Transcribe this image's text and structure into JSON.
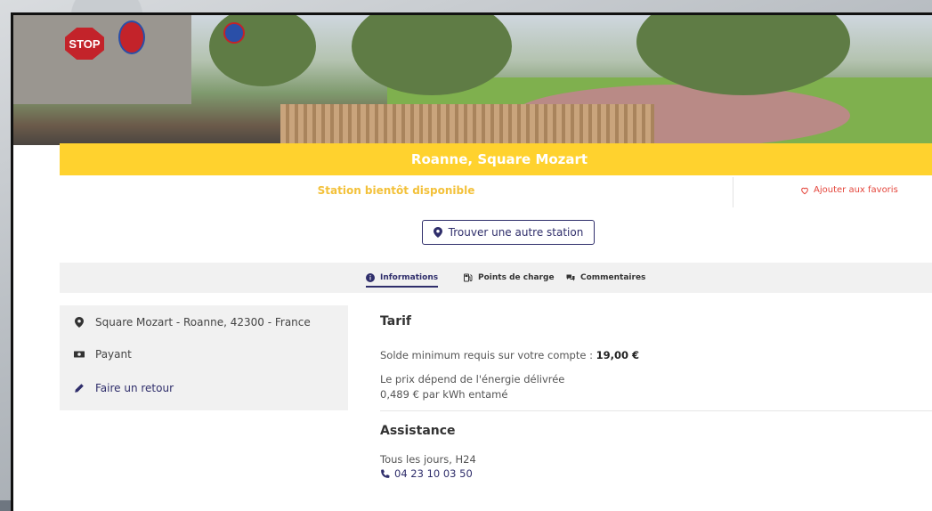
{
  "station": {
    "title": "Roanne, Square Mozart",
    "status": "Station bientôt disponible",
    "favorite_label": "Ajouter aux favoris",
    "find_button": "Trouver une autre station"
  },
  "photo": {
    "stop_sign": "STOP"
  },
  "tabs": [
    {
      "label": "Informations",
      "icon": "info-icon",
      "active": true
    },
    {
      "label": "Points de charge",
      "icon": "charging-station-icon",
      "active": false
    },
    {
      "label": "Commentaires",
      "icon": "comments-icon",
      "active": false
    }
  ],
  "sidebar": {
    "address": "Square Mozart - Roanne, 42300 - France",
    "payment": "Payant",
    "feedback": "Faire un retour"
  },
  "tarif": {
    "heading": "Tarif",
    "min_balance_label": "Solde minimum requis sur votre compte : ",
    "min_balance_value": "19,00 €",
    "price_line1": "Le prix dépend de l'énergie délivrée",
    "price_line2": "0,489 € par kWh entamé"
  },
  "assistance": {
    "heading": "Assistance",
    "hours": "Tous les jours, H24",
    "phone": "04 23 10 03 50"
  },
  "colors": {
    "accent_yellow": "#ffd22e",
    "status_yellow": "#f3c13a",
    "brand_navy": "#2f2e6b",
    "favorite_red": "#e4453b"
  }
}
